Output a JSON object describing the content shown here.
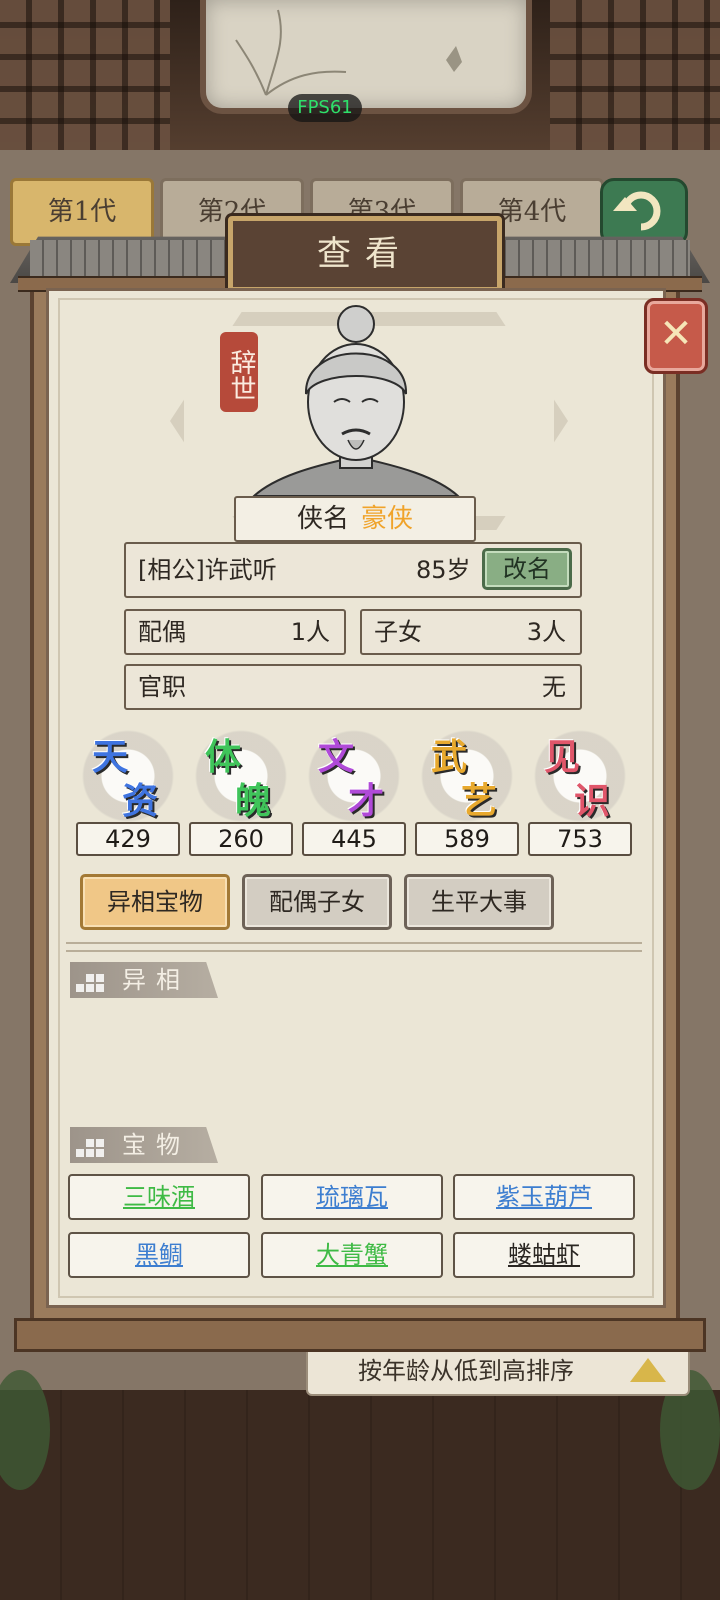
{
  "hud": {
    "fps": "FPS61"
  },
  "generation_tabs": [
    "第1代",
    "第2代",
    "第3代",
    "第4代"
  ],
  "sort_bar": {
    "label": "按年龄从低到高排序"
  },
  "dialog": {
    "title": "查看",
    "status_seal": "辞世",
    "hero_title": {
      "label": "侠名",
      "value": "豪侠"
    },
    "person": {
      "name": "[相公]许武听",
      "age": "85岁",
      "rename_label": "改名"
    },
    "spouse": {
      "label": "配偶",
      "value": "1人"
    },
    "children": {
      "label": "子女",
      "value": "3人"
    },
    "office": {
      "label": "官职",
      "value": "无"
    },
    "stats": [
      {
        "glyph_top": "天",
        "glyph_bottom": "资",
        "value": "429",
        "color": "#3f74e0"
      },
      {
        "glyph_top": "体",
        "glyph_bottom": "魄",
        "value": "260",
        "color": "#3fc45a"
      },
      {
        "glyph_top": "文",
        "glyph_bottom": "才",
        "value": "445",
        "color": "#b04ad8"
      },
      {
        "glyph_top": "武",
        "glyph_bottom": "艺",
        "value": "589",
        "color": "#e8a92e"
      },
      {
        "glyph_top": "见",
        "glyph_bottom": "识",
        "value": "753",
        "color": "#e0566a"
      }
    ],
    "tabs": [
      "异相宝物",
      "配偶子女",
      "生平大事"
    ],
    "sections": {
      "traits": "异相",
      "treasures": "宝物"
    },
    "treasures": [
      {
        "name": "三味酒",
        "color": "#3fba45"
      },
      {
        "name": "琉璃瓦",
        "color": "#3d7ed0"
      },
      {
        "name": "紫玉葫芦",
        "color": "#3d7ed0"
      },
      {
        "name": "黑鲷",
        "color": "#3d7ed0"
      },
      {
        "name": "大青蟹",
        "color": "#3fba45"
      },
      {
        "name": "蝼蛄虾",
        "color": "#2a2622"
      }
    ]
  }
}
